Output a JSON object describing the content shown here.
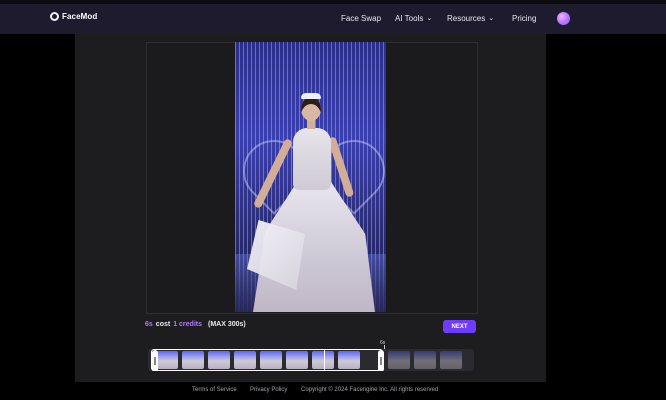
{
  "header": {
    "logo_text": "FaceMod",
    "nav": [
      {
        "label": "Face Swap",
        "has_chevron": false
      },
      {
        "label": "AI Tools",
        "has_chevron": true
      },
      {
        "label": "Resources",
        "has_chevron": true
      },
      {
        "label": "Pricing",
        "has_chevron": false
      }
    ],
    "chevron_glyph": "⌄"
  },
  "editor": {
    "cost": {
      "duration": "6s",
      "cost_word": "cost",
      "credits": "1 credits",
      "max": "(MAX 300s)"
    },
    "next_label": "NEXT",
    "timeline": {
      "playhead_label": "6s",
      "selection_start_fraction": 0.0,
      "selection_end_fraction": 0.72
    }
  },
  "footer": {
    "terms": "Terms of Service",
    "privacy": "Privacy Policy",
    "copyright": "Copyright © 2024 Facengine Inc. All rights reserved"
  },
  "colors": {
    "accent": "#6f3bff",
    "accent_text": "#b07cff",
    "navbar": "#1e1b2e",
    "panel": "#1d1d20"
  },
  "icons": {
    "logo": "facemod-logo-icon",
    "avatar": "user-avatar",
    "chevron": "chevron-down-icon"
  }
}
